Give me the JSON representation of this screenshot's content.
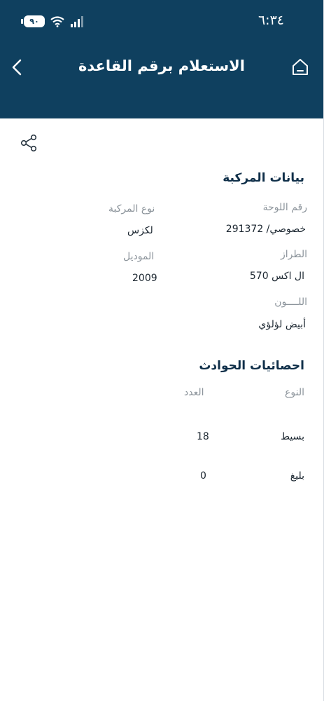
{
  "status_bar": {
    "time": "٦:٣٤",
    "battery": "٩٠"
  },
  "header": {
    "title": "الاستعلام برقم القاعدة",
    "back_icon": "chevron-left-icon",
    "home_icon": "home-icon"
  },
  "share": {
    "icon": "share-icon"
  },
  "vehicle": {
    "title": "بيانات المركبة",
    "fields": [
      {
        "label": "رقم اللوحة",
        "value": "خصوصي/ 291372"
      },
      {
        "label": "نوع المركبة",
        "value": "لكزس"
      },
      {
        "label": "الطراز",
        "value": "ال اكس 570"
      },
      {
        "label": "الموديل",
        "value": "2009"
      },
      {
        "label": "اللــــون",
        "value": "أبيض لؤلؤي"
      }
    ]
  },
  "accidents": {
    "title": "احصائيات الحوادث",
    "col_type": "النوع",
    "col_count": "العدد",
    "rows": [
      {
        "type": "بسيط",
        "count": "18"
      },
      {
        "type": "بليغ",
        "count": "0"
      }
    ]
  },
  "colors": {
    "header_bg": "#0f405f",
    "title_text": "#0f2f49",
    "label_text": "#8c949b"
  }
}
